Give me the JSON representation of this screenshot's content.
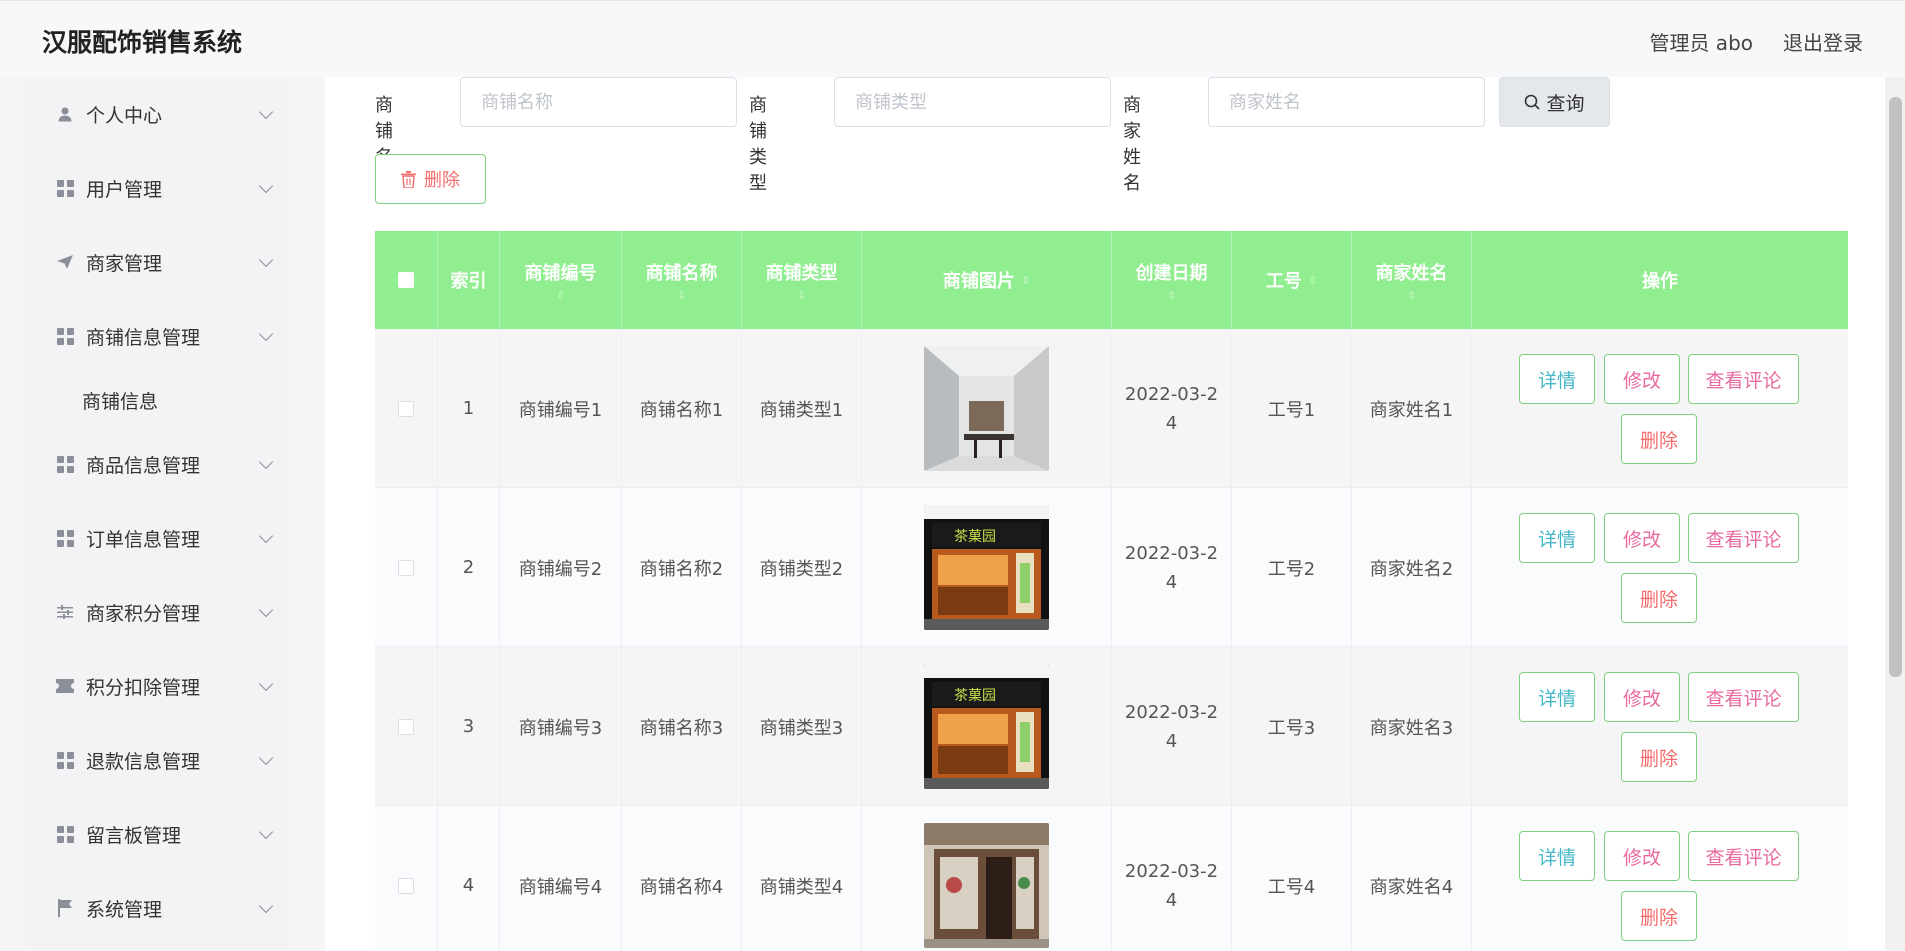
{
  "header": {
    "title": "汉服配饰销售系统",
    "user_label": "管理员 abo",
    "logout_label": "退出登录"
  },
  "sidebar": {
    "items": [
      {
        "label": "个人中心",
        "icon": "user-icon"
      },
      {
        "label": "用户管理",
        "icon": "grid-icon"
      },
      {
        "label": "商家管理",
        "icon": "send-icon"
      },
      {
        "label": "商铺信息管理",
        "icon": "grid-icon"
      },
      {
        "label": "商品信息管理",
        "icon": "grid-icon"
      },
      {
        "label": "订单信息管理",
        "icon": "grid-icon"
      },
      {
        "label": "商家积分管理",
        "icon": "sliders-icon"
      },
      {
        "label": "积分扣除管理",
        "icon": "ticket-icon"
      },
      {
        "label": "退款信息管理",
        "icon": "grid-icon"
      },
      {
        "label": "留言板管理",
        "icon": "grid-icon"
      },
      {
        "label": "系统管理",
        "icon": "flag-icon"
      }
    ],
    "sub_item": "商铺信息"
  },
  "search": {
    "shop_name_label": "商铺名称",
    "shop_name_placeholder": "商铺名称",
    "shop_type_label": "商铺类型",
    "shop_type_placeholder": "商铺类型",
    "merchant_name_label": "商家姓名",
    "merchant_name_placeholder": "商家姓名",
    "query_label": "查询"
  },
  "toolbar": {
    "delete_label": "删除"
  },
  "table": {
    "headers": {
      "index": "索引",
      "shop_no": "商铺编号",
      "shop_name": "商铺名称",
      "shop_type": "商铺类型",
      "shop_image": "商铺图片",
      "created": "创建日期",
      "work_no": "工号",
      "merchant": "商家姓名",
      "actions": "操作"
    },
    "sort_glyph": "⇕",
    "action_labels": {
      "detail": "详情",
      "edit": "修改",
      "comments": "查看评论",
      "delete": "删除"
    },
    "rows": [
      {
        "index": "1",
        "shop_no": "商铺编号1",
        "shop_name": "商铺名称1",
        "shop_type": "商铺类型1",
        "image": "interior",
        "created": "2022-03-24",
        "work_no": "工号1",
        "merchant": "商家姓名1"
      },
      {
        "index": "2",
        "shop_no": "商铺编号2",
        "shop_name": "商铺名称2",
        "shop_type": "商铺类型2",
        "image": "storefront-orange",
        "created": "2022-03-24",
        "work_no": "工号2",
        "merchant": "商家姓名2"
      },
      {
        "index": "3",
        "shop_no": "商铺编号3",
        "shop_name": "商铺名称3",
        "shop_type": "商铺类型3",
        "image": "storefront-orange",
        "created": "2022-03-24",
        "work_no": "工号3",
        "merchant": "商家姓名3"
      },
      {
        "index": "4",
        "shop_no": "商铺编号4",
        "shop_name": "商铺名称4",
        "shop_type": "商铺类型4",
        "image": "storefront-street",
        "created": "2022-03-24",
        "work_no": "工号4",
        "merchant": "商家姓名4"
      }
    ]
  }
}
